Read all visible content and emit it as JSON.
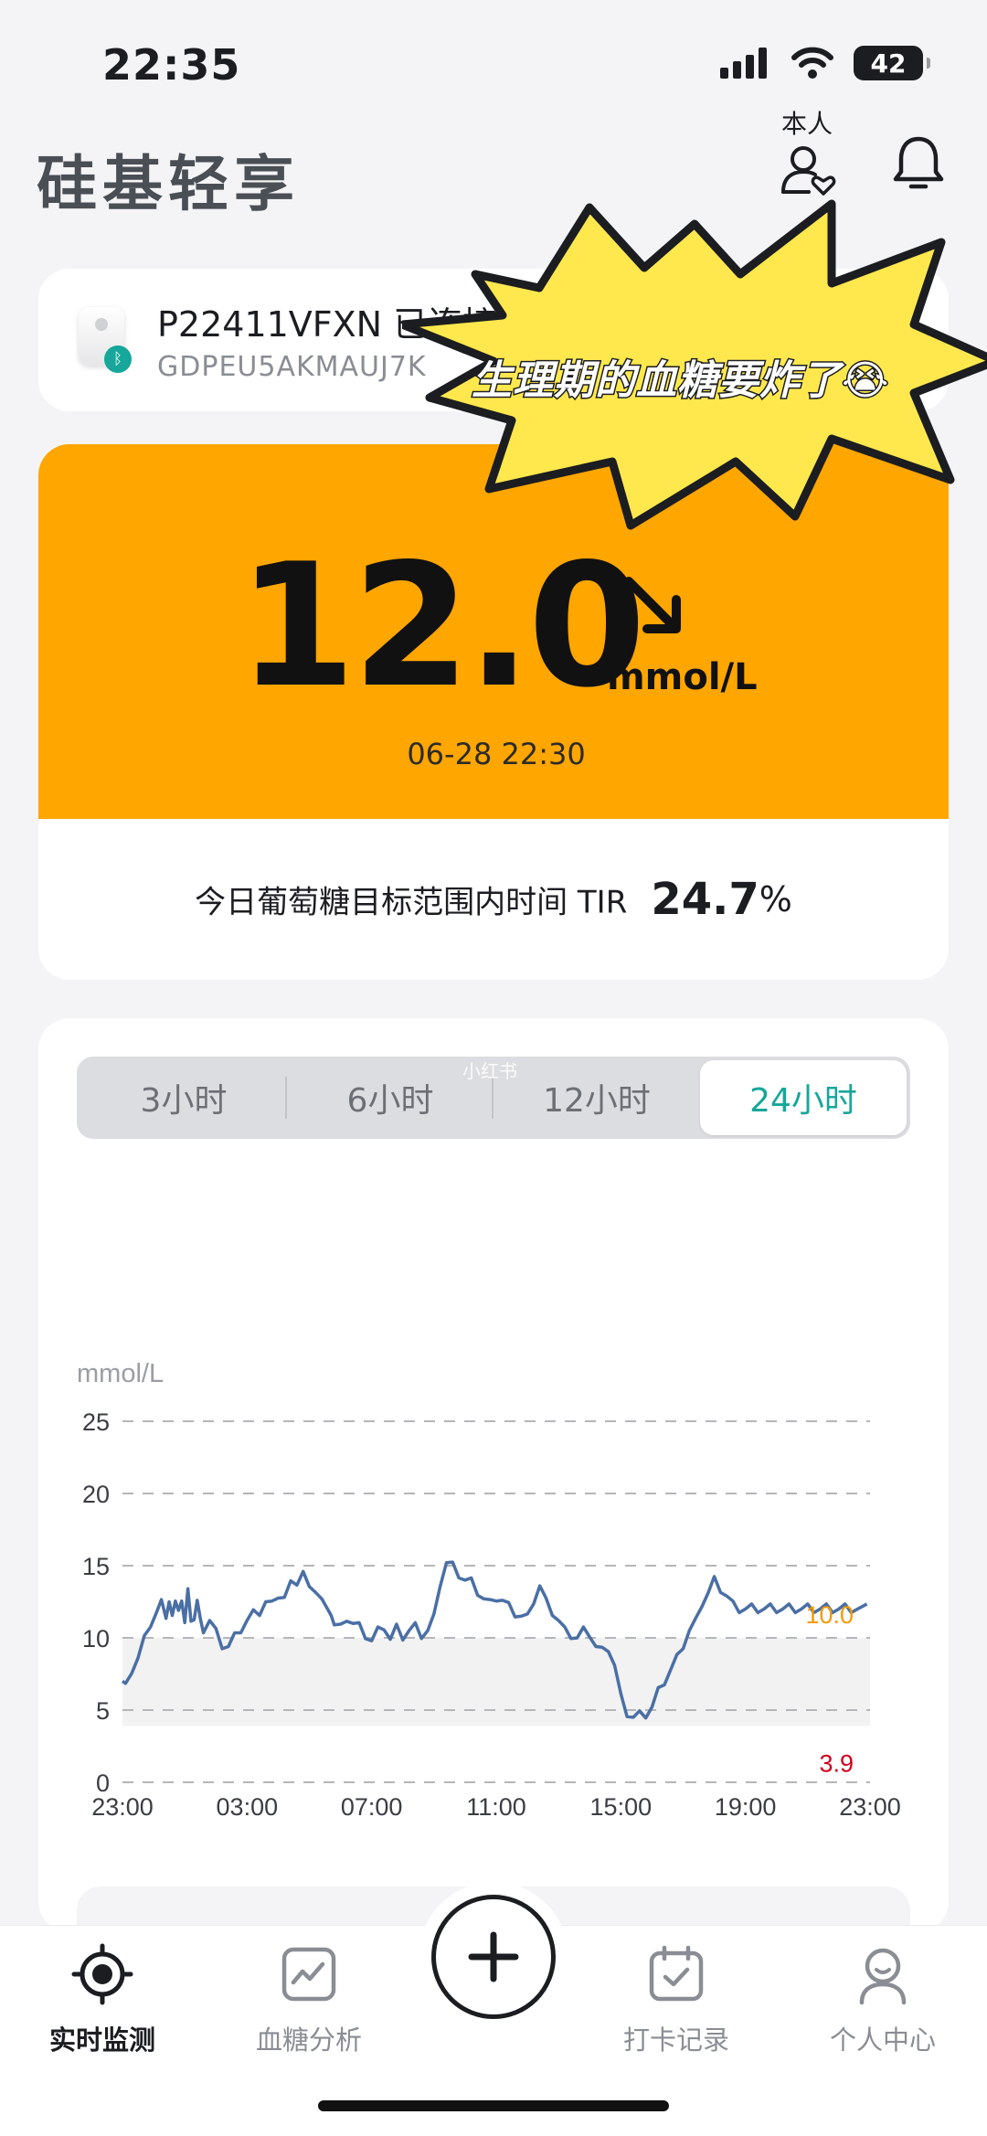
{
  "status_bar": {
    "time": "22:35",
    "battery": "42"
  },
  "header": {
    "title": "硅基轻享",
    "profile_label": "本人"
  },
  "device": {
    "name": "P22411VFXN 已连接",
    "serial": "GDPEU5AKMAUJ7K"
  },
  "sticker": {
    "text": "生理期的血糖要炸了😭"
  },
  "glucose": {
    "value": "12.0",
    "unit": "mmol/L",
    "timestamp": "06-28 22:30",
    "trend": "arrow-down-right-icon",
    "tir_label": "今日葡萄糖目标范围内时间 TIR",
    "tir_value": "24.7",
    "tir_unit": "%",
    "card_color": "#ffa600"
  },
  "range_tabs": {
    "items": [
      "3小时",
      "6小时",
      "12小时",
      "24小时"
    ],
    "selected": "24小时",
    "watermark": "小红书"
  },
  "chart_data": {
    "type": "line",
    "ylabel": "mmol/L",
    "ylim": [
      0,
      25
    ],
    "y_ticks": [
      "25",
      "20",
      "15",
      "10",
      "5",
      "0"
    ],
    "x_ticks": [
      "23:00",
      "03:00",
      "07:00",
      "11:00",
      "15:00",
      "19:00",
      "23:00"
    ],
    "target_range": {
      "low": "3.9",
      "high": "10.0",
      "low_color": "#d0021b",
      "high_color": "#f59a00"
    },
    "series": [
      {
        "color": "#4a6fa5",
        "hours": [
          0,
          0.1,
          0.3,
          0.5,
          0.7,
          0.9,
          1.1,
          1.25,
          1.4,
          1.5,
          1.6,
          1.7,
          1.8,
          1.9,
          2.0,
          2.1,
          2.2,
          2.3,
          2.4,
          2.5,
          2.6,
          2.8,
          3.0,
          3.2,
          3.4,
          3.6,
          3.8,
          4.0,
          4.2,
          4.4,
          4.6,
          4.8,
          5.0,
          5.2,
          5.4,
          5.6,
          5.8,
          6.0,
          6.2,
          6.4,
          6.6,
          6.7,
          6.8,
          7.0,
          7.2,
          7.4,
          7.6,
          7.8,
          8.0,
          8.2,
          8.4,
          8.6,
          8.8,
          9.0,
          9.2,
          9.4,
          9.6,
          9.8,
          10.0,
          10.2,
          10.4,
          10.6,
          10.8,
          11.0,
          11.2,
          11.4,
          11.6,
          11.8,
          12.0,
          12.2,
          12.4,
          12.6,
          12.8,
          13.0,
          13.2,
          13.4,
          13.6,
          13.8,
          14.0,
          14.2,
          14.4,
          14.6,
          14.8,
          15.0,
          15.2,
          15.4,
          15.6,
          15.8,
          16.0,
          16.2,
          16.4,
          16.6,
          16.8,
          17.0,
          17.2,
          17.4,
          17.6,
          17.8,
          18.0,
          18.2,
          18.4,
          18.6,
          18.8,
          19.0,
          19.2,
          19.4,
          19.6,
          19.8,
          20.0,
          20.2,
          20.4,
          20.6,
          20.8,
          21.0,
          21.2,
          21.4,
          21.6,
          21.8,
          22.0,
          22.2,
          22.4,
          22.6,
          22.8,
          23.0,
          23.2,
          23.4,
          23.6,
          23.9
        ],
        "values": [
          7.0,
          6.5,
          7.8,
          8.6,
          9.8,
          11.0,
          11.8,
          12.3,
          11.6,
          12.5,
          11.2,
          12.8,
          11.9,
          12.2,
          11.3,
          13.4,
          10.8,
          11.5,
          12.6,
          11.0,
          10.6,
          11.2,
          10.3,
          9.5,
          9.4,
          10.0,
          10.6,
          11.2,
          11.6,
          11.8,
          12.5,
          12.2,
          13.0,
          12.8,
          13.6,
          13.9,
          14.6,
          13.2,
          13.4,
          12.7,
          11.6,
          11.8,
          10.9,
          10.6,
          11.4,
          11.0,
          10.7,
          10.2,
          9.8,
          10.4,
          10.8,
          9.9,
          10.6,
          10.1,
          10.5,
          10.7,
          10.2,
          10.5,
          11.3,
          13.8,
          15.2,
          14.9,
          14.4,
          14.0,
          13.8,
          13.2,
          12.7,
          12.3,
          12.8,
          12.6,
          12.1,
          11.7,
          11.5,
          11.3,
          12.6,
          13.6,
          12.4,
          11.8,
          11.2,
          10.4,
          10.2,
          10.0,
          10.4,
          10.3,
          9.4,
          9.0,
          9.3,
          8.1,
          5.8,
          4.8,
          4.5,
          4.6,
          4.7,
          5.2,
          6.2,
          7.0,
          7.8,
          8.5,
          9.5,
          10.5,
          11.0,
          12.4,
          13.1,
          13.9,
          13.4,
          12.9,
          12.2,
          12.0,
          12.0,
          12.0,
          12.0,
          12.0,
          12.0,
          12.0,
          12.0,
          12.0,
          12.0,
          12.0,
          12.0,
          12.0,
          12.0,
          12.0,
          12.0,
          12.0,
          12.0,
          12.0,
          12.0,
          12.0
        ]
      }
    ],
    "grid": true
  },
  "tabbar": {
    "items": [
      {
        "label": "实时监测",
        "icon": "target-icon"
      },
      {
        "label": "血糖分析",
        "icon": "chart-icon"
      },
      {
        "label": "打卡记录",
        "icon": "calendar-check-icon"
      },
      {
        "label": "个人中心",
        "icon": "person-icon"
      }
    ],
    "active": "实时监测"
  }
}
